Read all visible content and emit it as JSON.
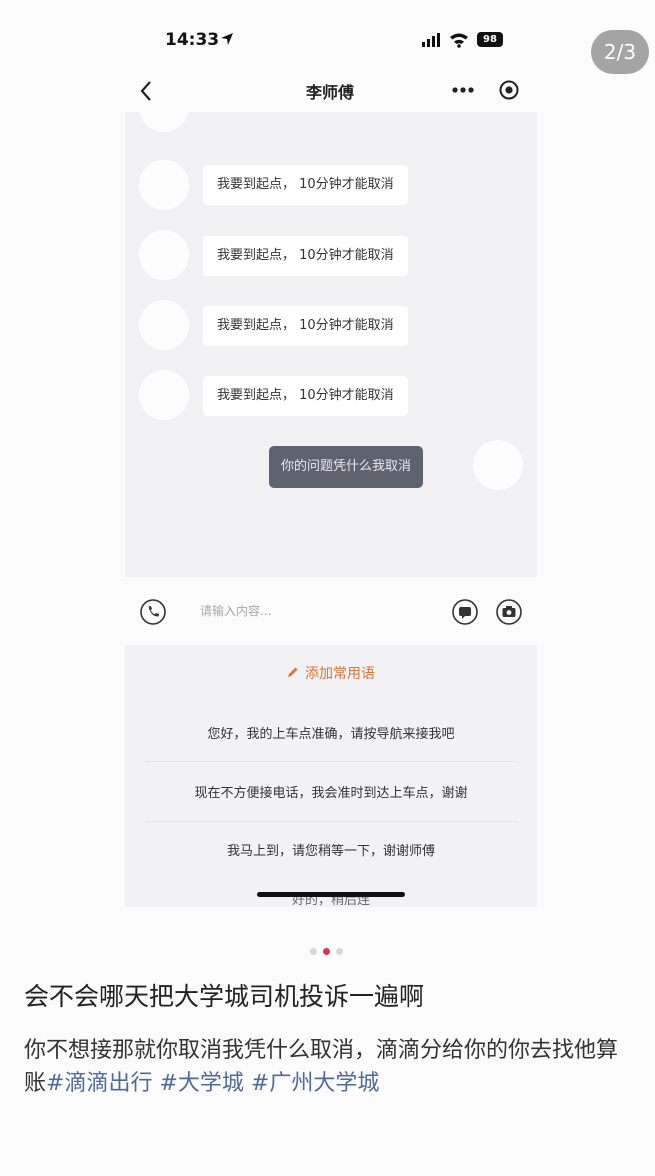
{
  "page_counter": "2/3",
  "status_bar": {
    "time": "14:33",
    "battery": "98"
  },
  "nav": {
    "title": "李师傅"
  },
  "chat": {
    "driver_messages": [
      "我要到起点， 10分钟才能取消",
      "我要到起点， 10分钟才能取消",
      "我要到起点， 10分钟才能取消",
      "我要到起点， 10分钟才能取消"
    ],
    "user_message": "你的问题凭什么我取消"
  },
  "input": {
    "placeholder": "请输入内容..."
  },
  "phrases": {
    "add_label": "添加常用语",
    "items": [
      "您好，我的上车点准确，请按导航来接我吧",
      "现在不方便接电话，我会准时到达上车点，谢谢",
      "我马上到，请您稍等一下，谢谢师傅"
    ],
    "partial": "好的，稍后连"
  },
  "pagination": {
    "total": 3,
    "active": 2
  },
  "post": {
    "title": "会不会哪天把大学城司机投诉一遍啊",
    "body": "你不想接那就你取消我凭什么取消，滴滴分给你的你去找他算账",
    "tags": [
      "#滴滴出行",
      "#大学城",
      "#广州大学城"
    ]
  },
  "colors": {
    "accent": "#e0713a",
    "tag": "#4f6a9b",
    "active_dot": "#e2334a",
    "self_bubble": "#5f6370"
  }
}
